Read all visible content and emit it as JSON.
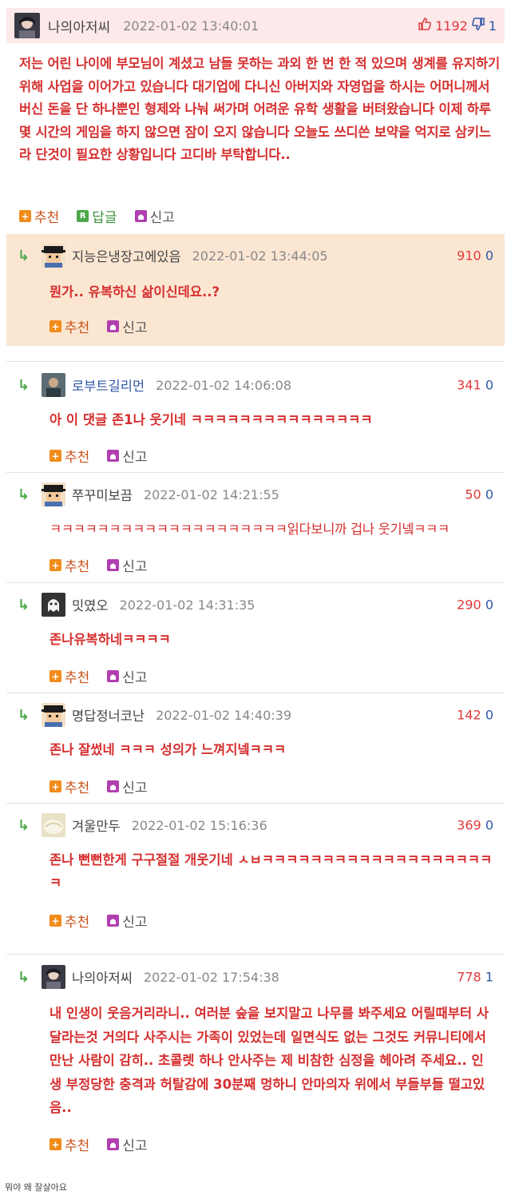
{
  "post": {
    "author": "나의아저씨",
    "date": "2022-01-02 13:40:01",
    "upvotes": "1192",
    "downvotes": "1",
    "body": "저는 어린 나이에 부모님이 계셨고 남들 못하는 과외 한 번 한 적 있으며 생계를 유지하기 위해 사업을 이어가고 있습니다 대기업에 다니신 아버지와 자영업을 하시는 어머니께서 버신 돈을 단 하나뿐인 형제와 나눠 써가며 어려운 유학 생활을 버텨왔습니다 이제 하루 몇 시간의 게임을 하지 않으면 잠이 오지 않습니다 오늘도 쓰디쓴 보약을 억지로 삼키느라 단것이 필요한 상황입니다 고디바 부탁합니다..",
    "actions": {
      "recommend": "추천",
      "reply": "답글",
      "report": "신고"
    }
  },
  "labels": {
    "recommend": "추천",
    "report": "신고"
  },
  "comments": [
    {
      "author": "지능은냉장고에있음",
      "date": "2022-01-02 13:44:05",
      "up": "910",
      "down": "0",
      "body": "뭔가.. 유복하신 삶이신데요..?"
    },
    {
      "author": "로부트길리먼",
      "date": "2022-01-02 14:06:08",
      "up": "341",
      "down": "0",
      "body": "아 이 댓글 존1나 웃기네 ㅋㅋㅋㅋㅋㅋㅋㅋㅋㅋㅋㅋㅋㅋㅋ"
    },
    {
      "author": "쭈꾸미보끔",
      "date": "2022-01-02 14:21:55",
      "up": "50",
      "down": "0",
      "body": "ㅋㅋㅋㅋㅋㅋㅋㅋㅋㅋㅋㅋㅋㅋㅋㅋㅋㅋㅋㅋ읽다보니까 겁나 웃기넼ㅋㅋㅋ"
    },
    {
      "author": "밋였오",
      "date": "2022-01-02 14:31:35",
      "up": "290",
      "down": "0",
      "body": "존나유복하네ㅋㅋㅋㅋ"
    },
    {
      "author": "명답정너코난",
      "date": "2022-01-02 14:40:39",
      "up": "142",
      "down": "0",
      "body": "존나 잘썼네 ㅋㅋㅋ 성의가 느껴지넼ㅋㅋㅋ"
    },
    {
      "author": "겨울만두",
      "date": "2022-01-02 15:16:36",
      "up": "369",
      "down": "0",
      "body": "존나 뻔뻔한게 구구절절 개웃기네 ㅅㅂㅋㅋㅋㅋㅋㅋㅋㅋㅋㅋㅋㅋㅋㅋㅋㅋㅋㅋㅋㅋ"
    },
    {
      "author": "나의아저씨",
      "date": "2022-01-02 17:54:38",
      "up": "778",
      "down": "1",
      "body": "내 인생이 웃음거리라니.. 여러분 숲을 보지말고 나무를 봐주세요 어릴때부터 사달라는것 거의다 사주시는 가족이 있었는데 일면식도 없는 그것도 커뮤니티에서 만난 사람이 감히.. 초콜렛 하나 안사주는 제 비참한 심정을 헤아려 주세요.. 인생 부정당한 충격과 허탈감에 30분째 멍하니 안마의자 위에서 부들부들 떨고있음.."
    }
  ],
  "caption": "뭐야 왜 잘살아요",
  "colors": {
    "accent_red": "#d62f2f",
    "up_red": "#e03a3a",
    "down_blue": "#2f56a8",
    "header_pink": "#fde8ea",
    "highlight_peach": "#fbe6d2"
  }
}
